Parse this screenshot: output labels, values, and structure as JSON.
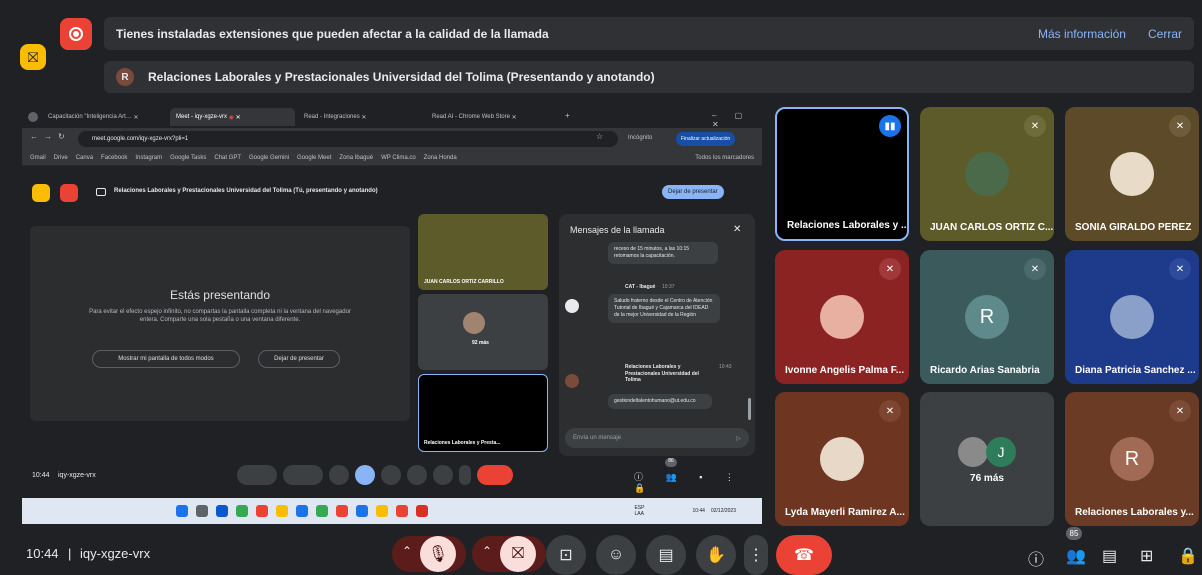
{
  "notice": {
    "text": "Tienes instaladas extensiones que pueden afectar a la calidad de la llamada",
    "more_info": "Más información",
    "close": "Cerrar"
  },
  "presenting": {
    "initial": "R",
    "text": "Relaciones Laborales y Prestacionales Universidad del Tolima (Presentando y anotando)"
  },
  "shared": {
    "tabs": [
      "Capacitación \"Inteligencia Art…",
      "Meet - iqy-xgze-vrx",
      "Read - Integraciones",
      "Read AI - Chrome Web Store"
    ],
    "url": "meet.google.com/iqy-xgze-vrx?pli=1",
    "incognito": "Incógnito",
    "update_btn": "Finalizar actualización",
    "bookmarks": [
      "Gmail",
      "Drive",
      "Canva",
      "Facebook",
      "Instagram",
      "Google Tasks",
      "Chat GPT",
      "Google Gemini",
      "Google Meet",
      "Zona Ibagué",
      "WP Clima.co",
      "Zona Honda"
    ],
    "bookmarks_all": "Todos los marcadores",
    "presenting_bar": "Relaciones Laborales y Prestacionales Universidad del Tolima (Tú, presentando y anotando)",
    "stop_presenting": "Dejar de presentar",
    "panel_title": "Estás presentando",
    "panel_text": "Para evitar el efecto espejo infinito, no compartas la pantalla completa ni la ventana del navegador entera. Comparte una sola pestaña o una ventana diferente.",
    "show_anyway": "Mostrar mi pantalla de todos modos",
    "stop": "Dejar de presentar",
    "tile1": "JUAN CARLOS ORTIZ CARRILLO",
    "tile2": "92 más",
    "tile3": "Relaciones Laborales y Presta...",
    "chat_title": "Mensajes de la llamada",
    "chat_msg1": "receso de 15 minutos, a las 10:15 retomamos la capacitación.",
    "chat_sender2": "CAT - Ibagué",
    "chat_time2": "10:37",
    "chat_msg2": "Saludo fraterno desde el Centro de Atención Tutorial de Ibagué y Cajamarca del IDEAD de la mejor Universidad de la Región",
    "chat_sender3": "Relaciones Laborales y Prestacionales Universidad del Tolima",
    "chat_time3": "10:43",
    "chat_msg3": "gestiondeltalentohumano@ut.edu.co",
    "chat_placeholder": "Envía un mensaje",
    "time": "10:44",
    "code": "iqy-xgze-vrx",
    "people_badge": "86",
    "task_lang": "ESP LAA",
    "task_time": "10:44",
    "task_date": "02/12/2023"
  },
  "tiles": [
    {
      "name": "Relaciones Laborales y ...",
      "bg": "#000000"
    },
    {
      "name": "JUAN CARLOS ORTIZ C...",
      "bg": "#5d5b2a"
    },
    {
      "name": "SONIA GIRALDO PEREZ",
      "bg": "#5c4a28"
    },
    {
      "name": "Ivonne Angelis Palma F...",
      "bg": "#8b2323"
    },
    {
      "name": "Ricardo Arias Sanabria",
      "bg": "#3a5a5c",
      "initial": "R"
    },
    {
      "name": "Diana Patricia Sanchez ...",
      "bg": "#1e3a8a"
    },
    {
      "name": "Lyda Mayerli Ramirez A...",
      "bg": "#6e3520"
    },
    {
      "name": "76 más",
      "bg": "#3c4043",
      "initial": "J"
    },
    {
      "name": "Relaciones Laborales y...",
      "bg": "#6b3b25",
      "initial": "R"
    }
  ],
  "bottom": {
    "time": "10:44",
    "code": "iqy-xgze-vrx",
    "people_badge": "85"
  },
  "colors": {
    "red": "#ea4335",
    "yellow": "#fbbc04",
    "dark": "#202124",
    "blue": "#8ab4f8"
  }
}
